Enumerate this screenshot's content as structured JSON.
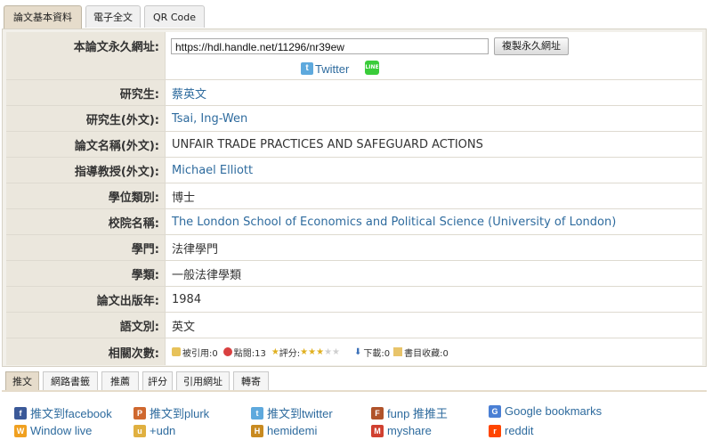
{
  "top_tabs": [
    "論文基本資料",
    "電子全文",
    "QR Code"
  ],
  "permalink": {
    "label": "本論文永久網址:",
    "url": "https://hdl.handle.net/11296/nr39ew",
    "copy_button": "複製永久網址",
    "twitter": "Twitter",
    "line_icon_text": "LINE"
  },
  "fields": [
    {
      "label": "研究生:",
      "value": "蔡英文",
      "link": true
    },
    {
      "label": "研究生(外文):",
      "value": "Tsai, Ing-Wen",
      "link": true
    },
    {
      "label": "論文名稱(外文):",
      "value": "UNFAIR TRADE PRACTICES AND SAFEGUARD ACTIONS",
      "link": false
    },
    {
      "label": "指導教授(外文):",
      "value": "Michael Elliott",
      "link": true
    },
    {
      "label": "學位類別:",
      "value": "博士",
      "link": false
    },
    {
      "label": "校院名稱:",
      "value": "The London School of Economics and Political Science (University of London)",
      "link": true
    },
    {
      "label": "學門:",
      "value": "法律學門",
      "link": false
    },
    {
      "label": "學類:",
      "value": "一般法律學類",
      "link": false
    },
    {
      "label": "論文出版年:",
      "value": "1984",
      "link": false
    },
    {
      "label": "語文別:",
      "value": "英文",
      "link": false
    }
  ],
  "stats": {
    "label": "相關次數:",
    "cited": "被引用:0",
    "clicks": "點閱:13",
    "rating_label": "評分:",
    "rating": 3,
    "rating_max": 5,
    "downloads": "下載:0",
    "bookmarks": "書目收藏:0"
  },
  "bottom_tabs": [
    "推文",
    "網路書籤",
    "推薦",
    "評分",
    "引用網址",
    "轉寄"
  ],
  "share_links": [
    {
      "text": "推文到facebook",
      "icon": "facebook-icon",
      "color": "#3b5998",
      "glyph": "f"
    },
    {
      "text": "推文到plurk",
      "icon": "plurk-icon",
      "color": "#cf682f",
      "glyph": "P"
    },
    {
      "text": "推文到twitter",
      "icon": "twitter-icon",
      "color": "#5ea9dd",
      "glyph": "t"
    },
    {
      "text": "funp 推推王",
      "icon": "funp-icon",
      "color": "#b0532a",
      "glyph": "F"
    },
    {
      "text": "Google bookmarks",
      "icon": "google-icon",
      "color": "#4a7fd4",
      "glyph": "G"
    },
    {
      "text": "Window live",
      "icon": "windows-live-icon",
      "color": "#f0a020",
      "glyph": "W"
    },
    {
      "text": "+udn",
      "icon": "udn-icon",
      "color": "#e0b040",
      "glyph": "u"
    },
    {
      "text": "hemidemi",
      "icon": "hemidemi-icon",
      "color": "#c88a20",
      "glyph": "H"
    },
    {
      "text": "myshare",
      "icon": "myshare-icon",
      "color": "#d04030",
      "glyph": "M"
    },
    {
      "text": "reddit",
      "icon": "reddit-icon",
      "color": "#ff4500",
      "glyph": "r"
    }
  ]
}
